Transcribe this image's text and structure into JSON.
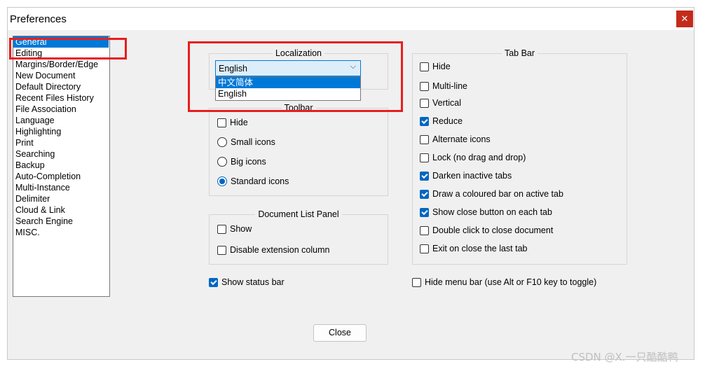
{
  "window": {
    "title": "Preferences",
    "close_glyph": "✕"
  },
  "sidebar": {
    "items": [
      {
        "label": "General",
        "selected": true
      },
      {
        "label": "Editing"
      },
      {
        "label": "Margins/Border/Edge"
      },
      {
        "label": "New Document"
      },
      {
        "label": "Default Directory"
      },
      {
        "label": "Recent Files History"
      },
      {
        "label": "File Association"
      },
      {
        "label": "Language"
      },
      {
        "label": "Highlighting"
      },
      {
        "label": "Print"
      },
      {
        "label": "Searching"
      },
      {
        "label": "Backup"
      },
      {
        "label": "Auto-Completion"
      },
      {
        "label": "Multi-Instance"
      },
      {
        "label": "Delimiter"
      },
      {
        "label": "Cloud & Link"
      },
      {
        "label": "Search Engine"
      },
      {
        "label": "MISC."
      }
    ]
  },
  "localization": {
    "title": "Localization",
    "selected": "English",
    "arrow_glyph": "⌵",
    "options": [
      "中文简体",
      "English"
    ]
  },
  "toolbar": {
    "title": "Toolbar",
    "options": [
      {
        "label": "Hide",
        "type": "checkbox",
        "checked": false
      },
      {
        "label": "Small icons",
        "type": "radio",
        "checked": false
      },
      {
        "label": "Big icons",
        "type": "radio",
        "checked": false
      },
      {
        "label": "Standard icons",
        "type": "radio",
        "checked": true
      }
    ]
  },
  "doc_list_panel": {
    "title": "Document List Panel",
    "options": [
      {
        "label": "Show",
        "checked": false
      },
      {
        "label": "Disable extension column",
        "checked": false
      }
    ]
  },
  "tab_bar": {
    "title": "Tab Bar",
    "options": [
      {
        "label": "Hide",
        "checked": false
      },
      {
        "label": "Multi-line",
        "checked": false
      },
      {
        "label": "Vertical",
        "checked": false
      },
      {
        "label": "Reduce",
        "checked": true
      },
      {
        "label": "Alternate icons",
        "checked": false
      },
      {
        "label": "Lock (no drag and drop)",
        "checked": false
      },
      {
        "label": "Darken inactive tabs",
        "checked": true
      },
      {
        "label": "Draw a coloured bar on active tab",
        "checked": true
      },
      {
        "label": "Show close button on each tab",
        "checked": true
      },
      {
        "label": "Double click to close document",
        "checked": false
      },
      {
        "label": "Exit on close the last tab",
        "checked": false
      }
    ]
  },
  "status_bar": {
    "label": "Show status bar",
    "checked": true
  },
  "menu_bar": {
    "label": "Hide menu bar (use Alt or F10 key to toggle)",
    "checked": false
  },
  "buttons": {
    "close": "Close"
  },
  "watermark": "CSDN @X.一只酷酷鸭"
}
